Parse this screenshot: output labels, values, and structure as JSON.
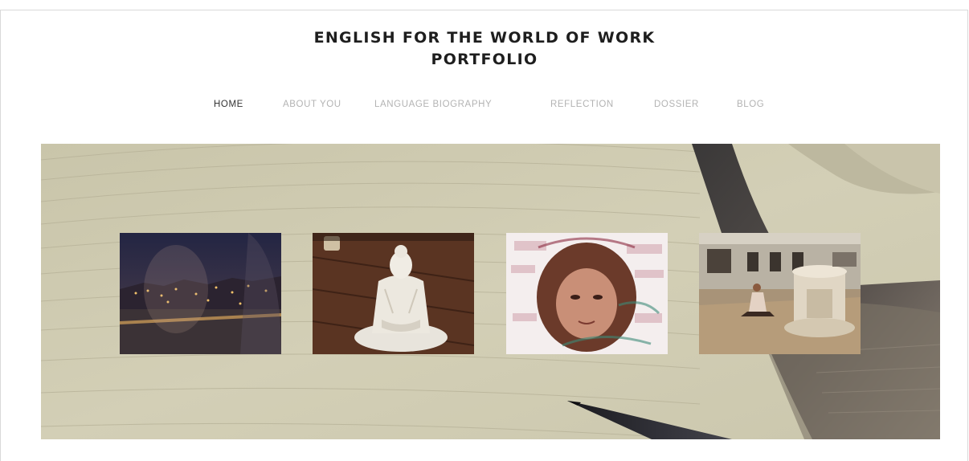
{
  "site": {
    "title_line1": "ENGLISH FOR THE WORLD OF WORK",
    "title_line2": "PORTFOLIO"
  },
  "nav": {
    "items": [
      {
        "label": "HOME",
        "active": true
      },
      {
        "label": "ABOUT YOU",
        "active": false
      },
      {
        "label": "LANGUAGE BIOGRAPHY",
        "active": false
      },
      {
        "label": "REFLECTION",
        "active": false
      },
      {
        "label": "DOSSIER",
        "active": false
      },
      {
        "label": "BLOG",
        "active": false
      }
    ]
  },
  "hero": {
    "thumbnails": [
      {
        "subject": "night city skyline over river",
        "icon": "photo-night-city"
      },
      {
        "subject": "white buddha statue on wooden table",
        "icon": "photo-buddha"
      },
      {
        "subject": "face portrait with multilingual word collage",
        "icon": "photo-word-collage"
      },
      {
        "subject": "person reading beside stone fountain",
        "icon": "photo-fountain"
      }
    ]
  },
  "colors": {
    "title": "#1e1e1e",
    "nav_active": "#333333",
    "nav_inactive": "#b3b3b3",
    "hero_background": "#cfcbb2"
  }
}
